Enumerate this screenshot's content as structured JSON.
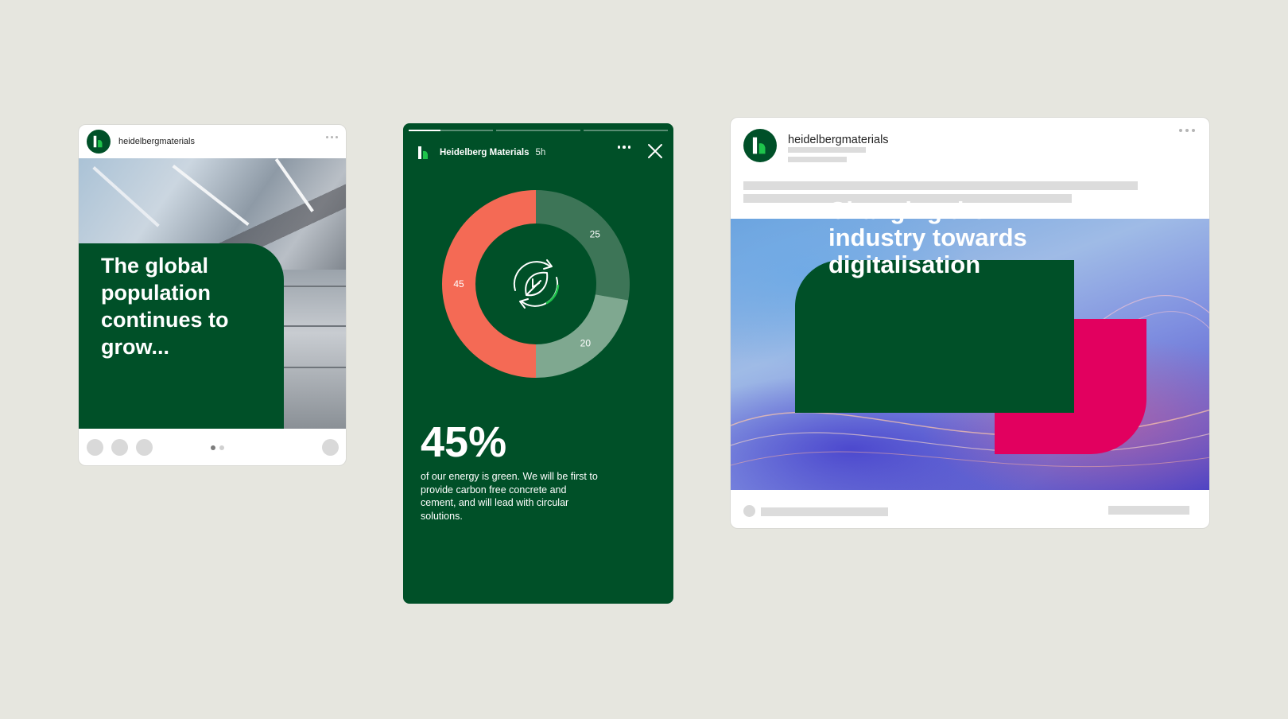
{
  "colors": {
    "brand_green": "#005028",
    "logo_light_green": "#1ec44b",
    "chart_salmon": "#f46a55",
    "chart_mid_green": "#3d7557",
    "chart_light_green": "#7fa890",
    "accent_pink": "#e2005f",
    "background": "#e6e6df"
  },
  "instagram_post": {
    "username": "heidelbergmaterials",
    "headline": "The global population continues to grow...",
    "pager": {
      "total": 2,
      "active": 1
    },
    "icons": [
      "logo-icon",
      "more-dots-icon",
      "like-icon",
      "comment-icon",
      "share-icon",
      "bookmark-icon"
    ]
  },
  "story": {
    "account_name": "Heidelberg Materials",
    "time_ago": "5h",
    "progress": [
      0.38,
      0,
      0
    ],
    "big_stat": "45%",
    "description": "of our energy is green. We will be first to provide carbon free concrete and cement, and will lead with circular solutions.",
    "center_icon": "recycle-leaf-icon",
    "icons": [
      "logo-icon",
      "more-dots-icon",
      "close-icon"
    ],
    "chart_data": {
      "type": "pie",
      "categories": [
        "25",
        "20",
        "45"
      ],
      "values": [
        25,
        20,
        45
      ],
      "series_colors": [
        "#3d7557",
        "#7fa890",
        "#f46a55"
      ],
      "labels": [
        "25",
        "20",
        "45"
      ],
      "start_angle_deg": 0
    }
  },
  "linkedin_post": {
    "username": "heidelbergmaterials",
    "headline": "Changing the industry towards digitalisation",
    "icons": [
      "logo-icon",
      "more-dots-icon"
    ]
  }
}
